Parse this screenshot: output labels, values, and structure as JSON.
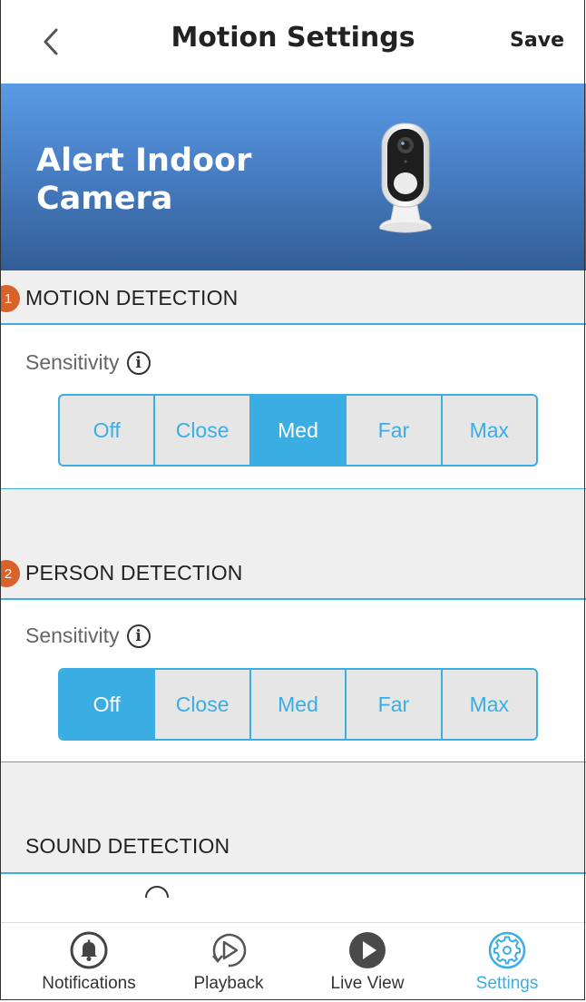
{
  "header": {
    "title": "Motion Settings",
    "save_label": "Save"
  },
  "banner": {
    "title_line1": "Alert Indoor",
    "title_line2": "Camera"
  },
  "sections": [
    {
      "marker": "1",
      "title": "MOTION DETECTION",
      "sensitivity_label": "Sensitivity",
      "selected": "Med"
    },
    {
      "marker": "2",
      "title": "PERSON DETECTION",
      "sensitivity_label": "Sensitivity",
      "selected": "Off"
    },
    {
      "marker": "",
      "title": "SOUND DETECTION"
    }
  ],
  "sensitivity_options": [
    "Off",
    "Close",
    "Med",
    "Far",
    "Max"
  ],
  "tabs": [
    {
      "label": "Notifications",
      "icon": "bell-icon"
    },
    {
      "label": "Playback",
      "icon": "playback-icon"
    },
    {
      "label": "Live View",
      "icon": "play-circle-icon"
    },
    {
      "label": "Settings",
      "icon": "gear-icon",
      "active": true
    }
  ],
  "colors": {
    "accent": "#3aaee3",
    "marker": "#d9622a",
    "banner_top": "#5a9be6",
    "banner_bottom": "#325d96"
  }
}
